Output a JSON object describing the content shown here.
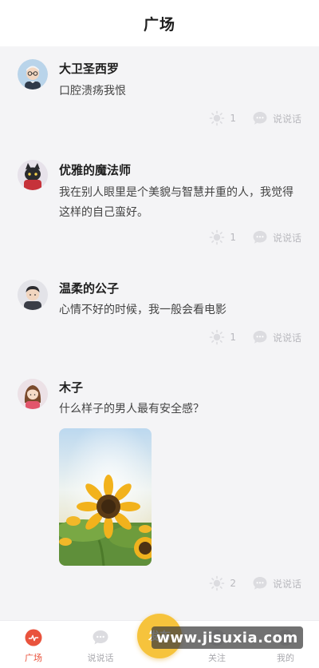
{
  "header": {
    "title": "广场"
  },
  "posts": [
    {
      "username": "大卫圣西罗",
      "content": "口腔溃疡我恨",
      "likes": "1",
      "comment_label": "说说话",
      "avatar": "man-glasses-avatar"
    },
    {
      "username": "优雅的魔法师",
      "content": "我在别人眼里是个美貌与智慧并重的人，我觉得这样的自己蛮好。",
      "likes": "1",
      "comment_label": "说说话",
      "avatar": "black-cat-avatar"
    },
    {
      "username": "温柔的公子",
      "content": "心情不好的时候，我一般会看电影",
      "likes": "1",
      "comment_label": "说说话",
      "avatar": "man-avatar"
    },
    {
      "username": "木子",
      "content": "什么样子的男人最有安全感？",
      "likes": "2",
      "comment_label": "说说话",
      "avatar": "woman-avatar",
      "image": "sunflower-photo"
    }
  ],
  "tabs": [
    {
      "label": "广场",
      "icon": "plaza-icon",
      "active": true
    },
    {
      "label": "说说话",
      "icon": "chat-icon",
      "active": false
    },
    {
      "label": "关注",
      "icon": "follow-icon",
      "active": false
    },
    {
      "label": "我的",
      "icon": "profile-icon",
      "active": false
    }
  ],
  "publish": {
    "label": "发布"
  },
  "watermark": "www.jisuxia.com",
  "colors": {
    "accent": "#e9533d",
    "publish": "#f6c33c",
    "muted": "#b9b9be"
  }
}
